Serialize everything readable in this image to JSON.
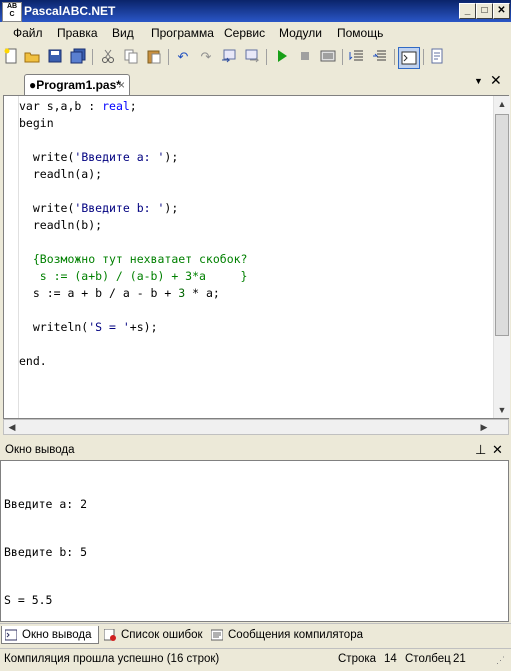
{
  "window": {
    "title": "PascalABC.NET",
    "icon_text": "AB\nC"
  },
  "menu": {
    "items": [
      "Файл",
      "Правка",
      "Вид",
      "Программа",
      "Сервис",
      "Модули",
      "Помощь"
    ]
  },
  "toolbar": {
    "icons": [
      "new-file-icon",
      "open-file-icon",
      "save-icon",
      "save-all-icon",
      "cut-icon",
      "copy-icon",
      "paste-icon",
      "undo-icon",
      "redo-icon",
      "navigate-back-icon",
      "navigate-forward-icon",
      "run-icon",
      "stop-icon",
      "compile-icon",
      "debug-step-icon",
      "debug-step-over-icon",
      "output-window-icon",
      "format-icon"
    ]
  },
  "editor": {
    "tab_label": "●Program1.pas*",
    "tab_close": "×",
    "close_glyph": "✕",
    "code_lines": [
      [
        {
          "t": "var s,a,b : ",
          "c": "kw"
        },
        {
          "t": "real",
          "c": "ty"
        },
        {
          "t": ";",
          "c": "kw"
        }
      ],
      [
        {
          "t": "begin",
          "c": "kw"
        }
      ],
      [],
      [
        {
          "t": "  write(",
          "c": "kw"
        },
        {
          "t": "'Введите a: '",
          "c": "str"
        },
        {
          "t": ");",
          "c": "kw"
        }
      ],
      [
        {
          "t": "  readln(a);",
          "c": "kw"
        }
      ],
      [],
      [
        {
          "t": "  write(",
          "c": "kw"
        },
        {
          "t": "'Введите b: '",
          "c": "str"
        },
        {
          "t": ");",
          "c": "kw"
        }
      ],
      [
        {
          "t": "  readln(b);",
          "c": "kw"
        }
      ],
      [],
      [
        {
          "t": "  {Возможно тут нехватает скобок?",
          "c": "cm"
        }
      ],
      [
        {
          "t": "   s := (a+b) / (a-b) + 3*a     }",
          "c": "cm"
        }
      ],
      [
        {
          "t": "  s := a + b / a - b + ",
          "c": "kw"
        },
        {
          "t": "3",
          "c": "num"
        },
        {
          "t": " * a;",
          "c": "kw"
        }
      ],
      [],
      [
        {
          "t": "  writeln(",
          "c": "kw"
        },
        {
          "t": "'S = '",
          "c": "str"
        },
        {
          "t": "+s);",
          "c": "kw"
        }
      ],
      [],
      [
        {
          "t": "end.",
          "c": "kw"
        }
      ]
    ]
  },
  "output": {
    "title": "Окно вывода",
    "pin_glyph": "ᵖ",
    "close_glyph": "✕",
    "lines": [
      "Введите a: 2",
      "Введите b: 5",
      "S = 5.5"
    ]
  },
  "bottom_tabs": [
    "Окно вывода",
    "Список ошибок",
    "Сообщения компилятора"
  ],
  "status": {
    "message": "Компиляция прошла успешно (16 строк)",
    "row_label": "Строка",
    "row_value": "14",
    "col_label": "Столбец",
    "col_value": "21"
  }
}
